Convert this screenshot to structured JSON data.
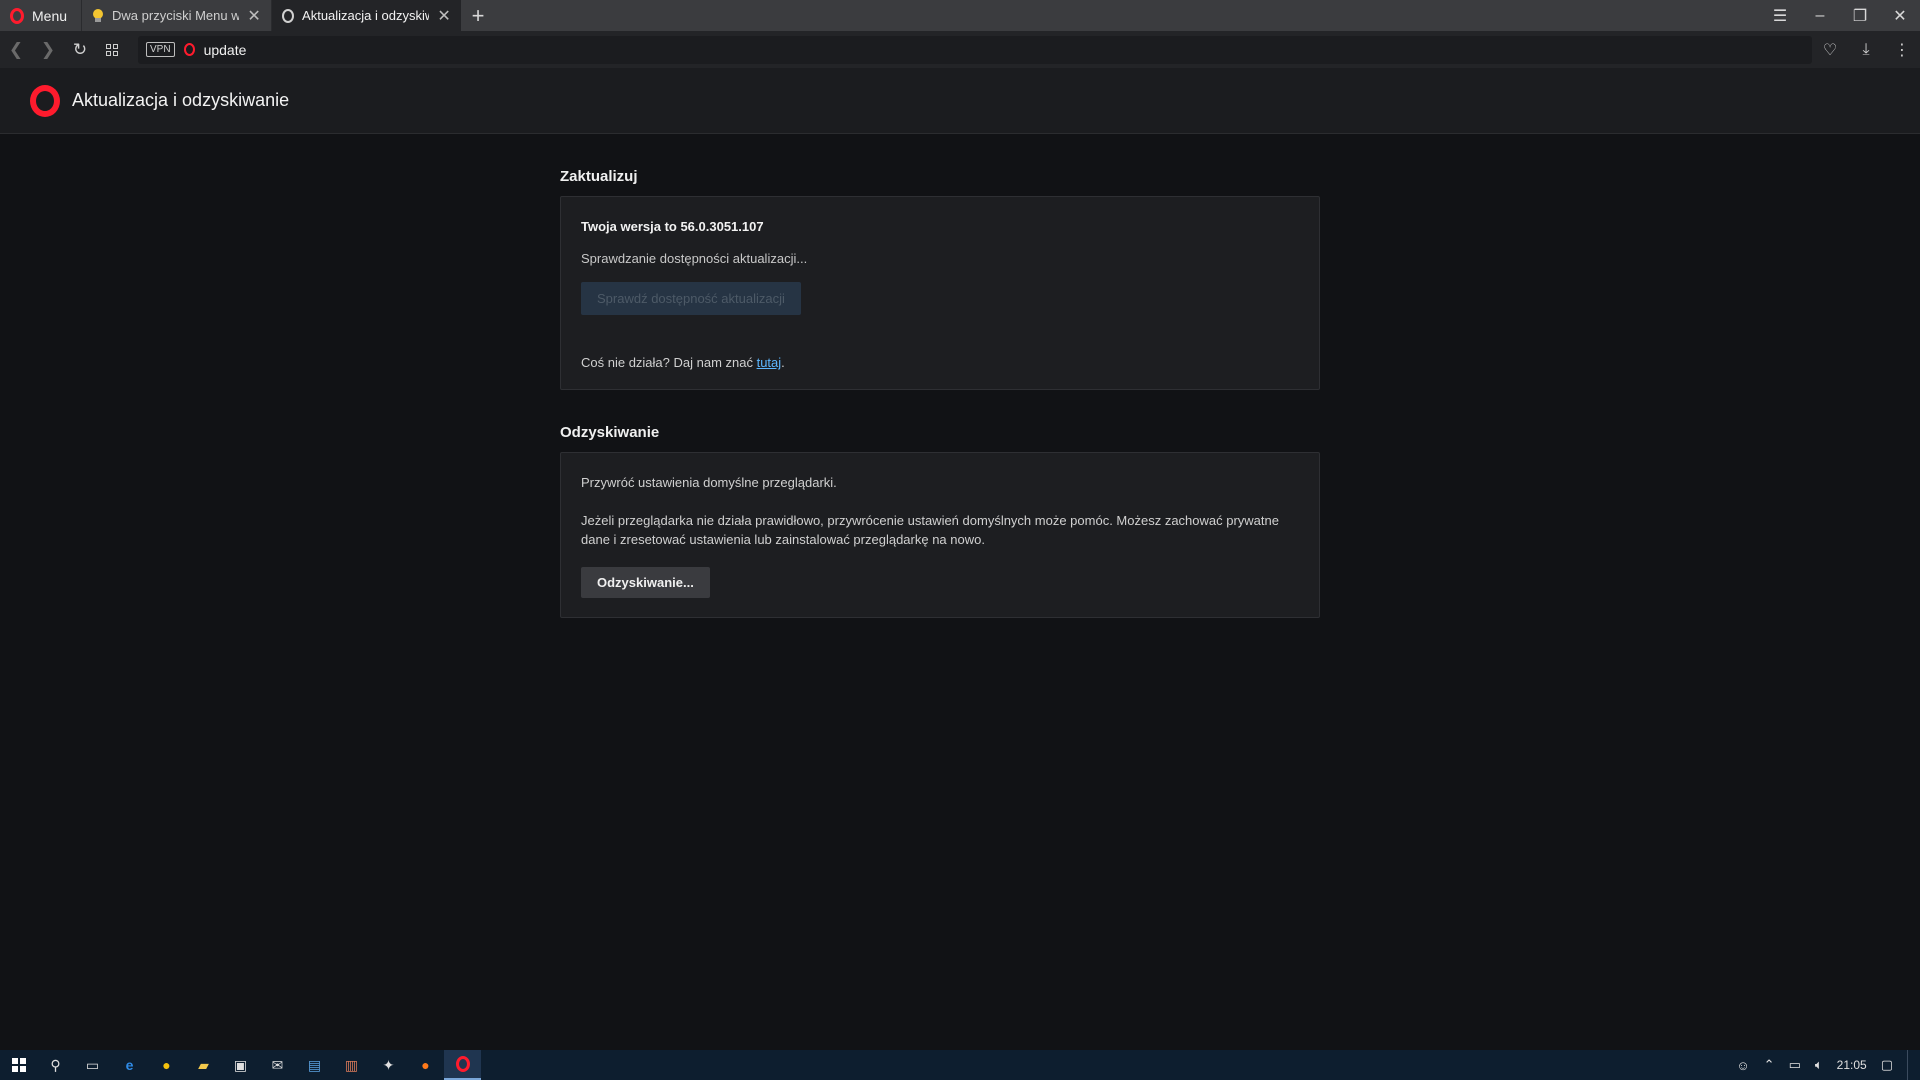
{
  "browser": {
    "menu_label": "Menu",
    "tabs": [
      {
        "title": "Dwa przyciski Menu w prz",
        "icon": "bulb-icon"
      },
      {
        "title": "Aktualizacja i odzyskiwanie",
        "icon": "opera-icon"
      }
    ],
    "address": {
      "vpn_label": "VPN",
      "url": "update"
    }
  },
  "page": {
    "title": "Aktualizacja i odzyskiwanie",
    "update": {
      "section_title": "Zaktualizuj",
      "version_text": "Twoja wersja to 56.0.3051.107",
      "status_text": "Sprawdzanie dostępności aktualizacji...",
      "check_button": "Sprawdź dostępność aktualizacji",
      "feedback_prefix": "Coś nie działa? Daj nam znać ",
      "feedback_link": "tutaj",
      "feedback_suffix": "."
    },
    "recovery": {
      "section_title": "Odzyskiwanie",
      "heading": "Przywróć ustawienia domyślne przeglądarki.",
      "description": "Jeżeli przeglądarka nie działa prawidłowo, przywrócenie ustawień domyślnych może pomóc. Możesz zachować prywatne dane i zresetować ustawienia lub zainstalować przeglądarkę na nowo.",
      "button": "Odzyskiwanie..."
    }
  },
  "taskbar": {
    "clock": "21:05"
  },
  "colors": {
    "accent": "#ff1b2d",
    "link": "#5db7ff",
    "background": "#111215"
  }
}
